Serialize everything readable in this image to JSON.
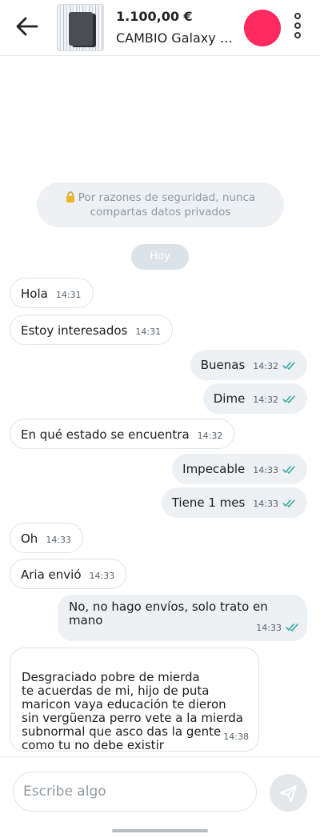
{
  "header": {
    "price": "1.100,00 €",
    "title": "CAMBIO Galaxy Z Fold",
    "avatar_color": "#ff2a5f"
  },
  "icons": {
    "back": "arrow-left-icon",
    "menu": "three-dots-vertical-icon",
    "lock": "lock-icon",
    "read": "double-check-icon",
    "send": "paper-plane-icon"
  },
  "security_notice": "Por razones de seguridad, nunca compartas datos privados",
  "day_label": "Hoy",
  "messages": [
    {
      "text": "Hola",
      "time": "14:31",
      "dir": "in"
    },
    {
      "text": "Estoy interesados",
      "time": "14:31",
      "dir": "in"
    },
    {
      "text": "Buenas",
      "time": "14:32",
      "dir": "out",
      "read": true
    },
    {
      "text": "Dime",
      "time": "14:32",
      "dir": "out",
      "read": true
    },
    {
      "text": "En qué estado se encuentra",
      "time": "14:32",
      "dir": "in"
    },
    {
      "text": "Impecable",
      "time": "14:33",
      "dir": "out",
      "read": true
    },
    {
      "text": "Tiene 1 mes",
      "time": "14:33",
      "dir": "out",
      "read": true
    },
    {
      "text": "Oh",
      "time": "14:33",
      "dir": "in"
    },
    {
      "text": "Aria envió",
      "time": "14:33",
      "dir": "in"
    },
    {
      "text": "No, no hago envíos, solo trato en mano",
      "time": "14:33",
      "dir": "out",
      "read": true
    },
    {
      "text": "Desgraciado pobre de mierda\nte acuerdas de mi, hijo de puta\nmaricon vaya educación te dieron\nsin vergüenza perro vete a la mierda\nsubnormal que asco das la gente\ncomo tu no debe existir",
      "time": "14:38",
      "dir": "in"
    }
  ],
  "composer": {
    "placeholder": "Escribe algo"
  },
  "colors": {
    "read_ticks": "#2aa7a0",
    "outgoing_bubble": "#eef1f4",
    "incoming_bubble": "#ffffff"
  }
}
